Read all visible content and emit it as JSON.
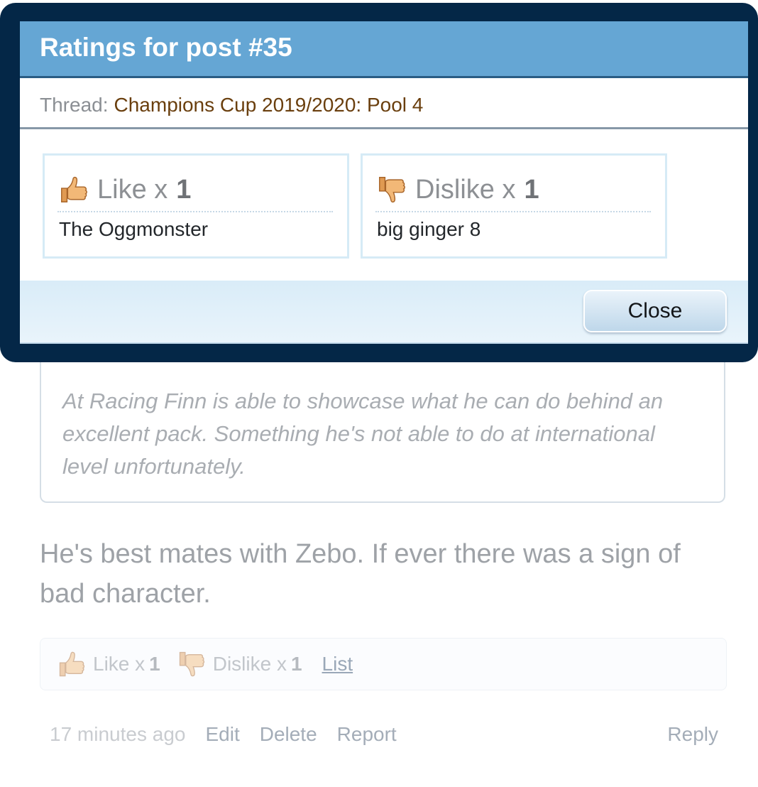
{
  "post": {
    "quote_text": "At Racing Finn is able to showcase what he can do behind an excellent pack. Something he's not able to do at international level unfortunately.",
    "body_text": "He's best mates with Zebo. If ever there was a sign of bad character.",
    "ratings": {
      "like_label": "Like x",
      "like_count": "1",
      "dislike_label": "Dislike x",
      "dislike_count": "1",
      "list_label": "List"
    },
    "footer": {
      "timestamp": "17 minutes ago",
      "edit_label": "Edit",
      "delete_label": "Delete",
      "report_label": "Report",
      "reply_label": "Reply"
    }
  },
  "dialog": {
    "title": "Ratings for post #35",
    "thread_label": "Thread:",
    "thread_title": "Champions Cup 2019/2020: Pool 4",
    "ratings": [
      {
        "icon": "thumbs-up-icon",
        "label": "Like x",
        "count": "1",
        "user": "The Oggmonster"
      },
      {
        "icon": "thumbs-down-icon",
        "label": "Dislike x",
        "count": "1",
        "user": "big ginger 8"
      }
    ],
    "close_label": "Close"
  },
  "colors": {
    "overlay_frame": "#042747",
    "header_bg": "#65a6d4",
    "thread_link": "#6a3f0e",
    "card_border": "#d6ebf6"
  }
}
